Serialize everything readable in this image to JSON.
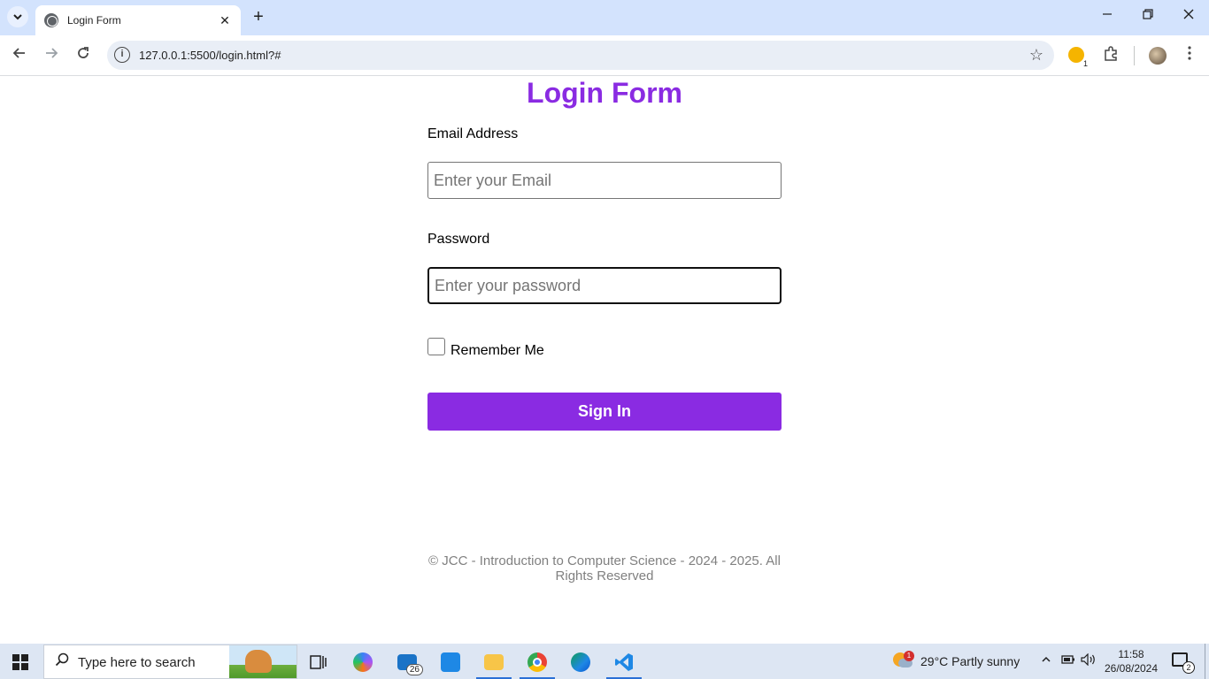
{
  "browser": {
    "tab_title": "Login Form",
    "tab_close": "✕",
    "new_tab": "+",
    "url": "127.0.0.1:5500/login.html?#",
    "extension_badge": "1"
  },
  "form": {
    "title": "Login Form",
    "email_label": "Email Address",
    "email_placeholder": "Enter your Email",
    "password_label": "Password",
    "password_placeholder": "Enter your password",
    "remember_label": "Remember Me",
    "signin_label": "Sign In"
  },
  "footer": {
    "text": "© JCC - Introduction to Computer Science - 2024 - 2025. All Rights Reserved"
  },
  "taskbar": {
    "search_placeholder": "Type here to search",
    "mail_badge": "26",
    "weather_badge": "1",
    "weather": "29°C  Partly sunny",
    "time": "11:58",
    "date": "26/08/2024",
    "notifications": "2"
  },
  "colors": {
    "accent": "#8a2be2",
    "tabstrip": "#d3e3fd",
    "footer_text": "#808080"
  }
}
